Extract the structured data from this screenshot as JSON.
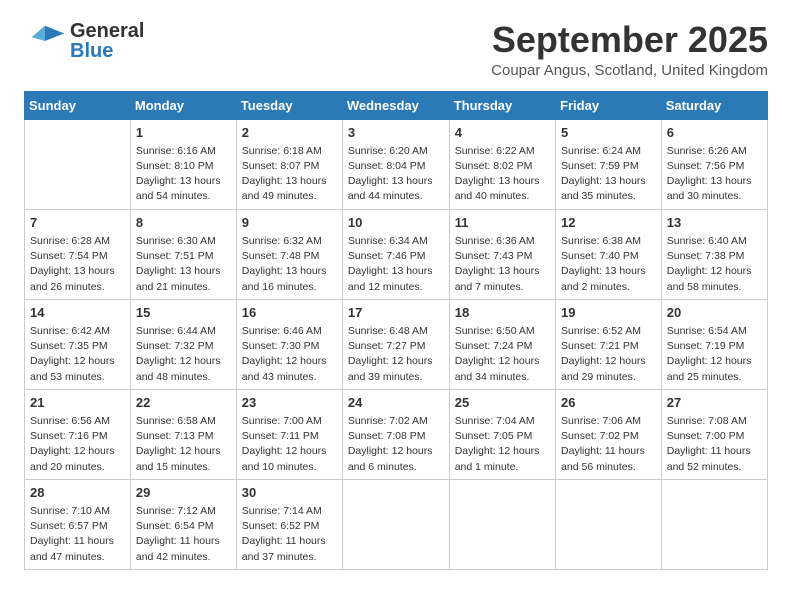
{
  "header": {
    "logo_general": "General",
    "logo_blue": "Blue",
    "month_title": "September 2025",
    "location": "Coupar Angus, Scotland, United Kingdom"
  },
  "weekdays": [
    "Sunday",
    "Monday",
    "Tuesday",
    "Wednesday",
    "Thursday",
    "Friday",
    "Saturday"
  ],
  "weeks": [
    [
      {
        "day": "",
        "info": ""
      },
      {
        "day": "1",
        "info": "Sunrise: 6:16 AM\nSunset: 8:10 PM\nDaylight: 13 hours\nand 54 minutes."
      },
      {
        "day": "2",
        "info": "Sunrise: 6:18 AM\nSunset: 8:07 PM\nDaylight: 13 hours\nand 49 minutes."
      },
      {
        "day": "3",
        "info": "Sunrise: 6:20 AM\nSunset: 8:04 PM\nDaylight: 13 hours\nand 44 minutes."
      },
      {
        "day": "4",
        "info": "Sunrise: 6:22 AM\nSunset: 8:02 PM\nDaylight: 13 hours\nand 40 minutes."
      },
      {
        "day": "5",
        "info": "Sunrise: 6:24 AM\nSunset: 7:59 PM\nDaylight: 13 hours\nand 35 minutes."
      },
      {
        "day": "6",
        "info": "Sunrise: 6:26 AM\nSunset: 7:56 PM\nDaylight: 13 hours\nand 30 minutes."
      }
    ],
    [
      {
        "day": "7",
        "info": "Sunrise: 6:28 AM\nSunset: 7:54 PM\nDaylight: 13 hours\nand 26 minutes."
      },
      {
        "day": "8",
        "info": "Sunrise: 6:30 AM\nSunset: 7:51 PM\nDaylight: 13 hours\nand 21 minutes."
      },
      {
        "day": "9",
        "info": "Sunrise: 6:32 AM\nSunset: 7:48 PM\nDaylight: 13 hours\nand 16 minutes."
      },
      {
        "day": "10",
        "info": "Sunrise: 6:34 AM\nSunset: 7:46 PM\nDaylight: 13 hours\nand 12 minutes."
      },
      {
        "day": "11",
        "info": "Sunrise: 6:36 AM\nSunset: 7:43 PM\nDaylight: 13 hours\nand 7 minutes."
      },
      {
        "day": "12",
        "info": "Sunrise: 6:38 AM\nSunset: 7:40 PM\nDaylight: 13 hours\nand 2 minutes."
      },
      {
        "day": "13",
        "info": "Sunrise: 6:40 AM\nSunset: 7:38 PM\nDaylight: 12 hours\nand 58 minutes."
      }
    ],
    [
      {
        "day": "14",
        "info": "Sunrise: 6:42 AM\nSunset: 7:35 PM\nDaylight: 12 hours\nand 53 minutes."
      },
      {
        "day": "15",
        "info": "Sunrise: 6:44 AM\nSunset: 7:32 PM\nDaylight: 12 hours\nand 48 minutes."
      },
      {
        "day": "16",
        "info": "Sunrise: 6:46 AM\nSunset: 7:30 PM\nDaylight: 12 hours\nand 43 minutes."
      },
      {
        "day": "17",
        "info": "Sunrise: 6:48 AM\nSunset: 7:27 PM\nDaylight: 12 hours\nand 39 minutes."
      },
      {
        "day": "18",
        "info": "Sunrise: 6:50 AM\nSunset: 7:24 PM\nDaylight: 12 hours\nand 34 minutes."
      },
      {
        "day": "19",
        "info": "Sunrise: 6:52 AM\nSunset: 7:21 PM\nDaylight: 12 hours\nand 29 minutes."
      },
      {
        "day": "20",
        "info": "Sunrise: 6:54 AM\nSunset: 7:19 PM\nDaylight: 12 hours\nand 25 minutes."
      }
    ],
    [
      {
        "day": "21",
        "info": "Sunrise: 6:56 AM\nSunset: 7:16 PM\nDaylight: 12 hours\nand 20 minutes."
      },
      {
        "day": "22",
        "info": "Sunrise: 6:58 AM\nSunset: 7:13 PM\nDaylight: 12 hours\nand 15 minutes."
      },
      {
        "day": "23",
        "info": "Sunrise: 7:00 AM\nSunset: 7:11 PM\nDaylight: 12 hours\nand 10 minutes."
      },
      {
        "day": "24",
        "info": "Sunrise: 7:02 AM\nSunset: 7:08 PM\nDaylight: 12 hours\nand 6 minutes."
      },
      {
        "day": "25",
        "info": "Sunrise: 7:04 AM\nSunset: 7:05 PM\nDaylight: 12 hours\nand 1 minute."
      },
      {
        "day": "26",
        "info": "Sunrise: 7:06 AM\nSunset: 7:02 PM\nDaylight: 11 hours\nand 56 minutes."
      },
      {
        "day": "27",
        "info": "Sunrise: 7:08 AM\nSunset: 7:00 PM\nDaylight: 11 hours\nand 52 minutes."
      }
    ],
    [
      {
        "day": "28",
        "info": "Sunrise: 7:10 AM\nSunset: 6:57 PM\nDaylight: 11 hours\nand 47 minutes."
      },
      {
        "day": "29",
        "info": "Sunrise: 7:12 AM\nSunset: 6:54 PM\nDaylight: 11 hours\nand 42 minutes."
      },
      {
        "day": "30",
        "info": "Sunrise: 7:14 AM\nSunset: 6:52 PM\nDaylight: 11 hours\nand 37 minutes."
      },
      {
        "day": "",
        "info": ""
      },
      {
        "day": "",
        "info": ""
      },
      {
        "day": "",
        "info": ""
      },
      {
        "day": "",
        "info": ""
      }
    ]
  ]
}
